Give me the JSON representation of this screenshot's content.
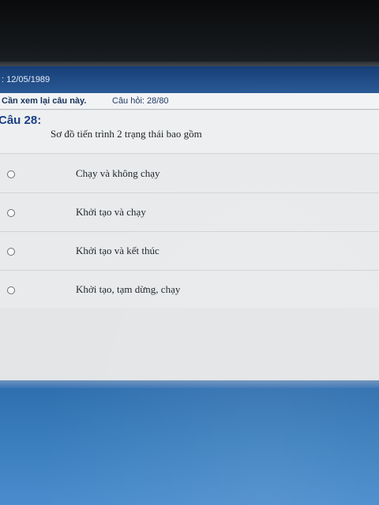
{
  "header": {
    "date_text": ": 12/05/1989"
  },
  "toolbar": {
    "review_label": "Cần xem lại câu này.",
    "question_counter": "Câu hỏi: 28/80"
  },
  "question": {
    "number_label": "Câu 28:",
    "text": "Sơ đồ tiến trình 2 trạng thái bao gồm"
  },
  "options": [
    {
      "label": "Chạy và không chạy"
    },
    {
      "label": "Khởi tạo và chạy"
    },
    {
      "label": "Khởi tạo và kết thúc"
    },
    {
      "label": "Khởi tạo, tạm dừng, chạy"
    }
  ]
}
